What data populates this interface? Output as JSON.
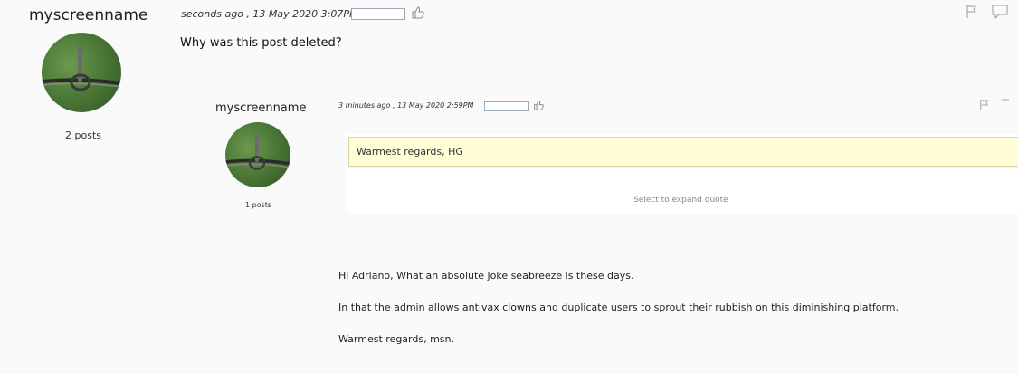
{
  "post": {
    "username": "myscreenname",
    "post_count": "2 posts",
    "timestamp": "seconds ago , 13 May 2020 3:07PM",
    "text": "Why was this post deleted?",
    "icons": {
      "like": "thumbs-up-icon",
      "flag": "flag-icon",
      "reply": "reply-bubble-icon"
    }
  },
  "quoted_post": {
    "username": "myscreenname",
    "post_count": "1 posts",
    "timestamp": "3 minutes ago , 13 May 2020 2:59PM",
    "quote_text": "Warmest regards, HG",
    "expand_label": "Select to expand quote",
    "paragraphs": [
      "Hi Adriano, What an absolute joke seabreeze is these days.",
      "In that the admin allows antivax clowns and duplicate users to sprout their rubbish on this diminishing platform.",
      "Warmest regards, msn."
    ]
  },
  "colors": {
    "quote_background": "#fffed6",
    "background": "#fafafa",
    "avatar_green": "#4d7a37"
  }
}
